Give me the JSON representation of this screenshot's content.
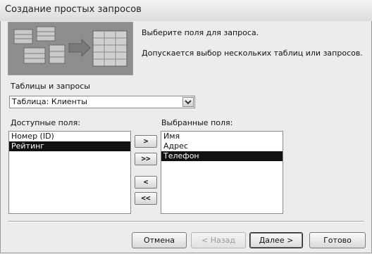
{
  "window": {
    "title": "Создание простых запросов"
  },
  "intro": {
    "line1": "Выберите поля для запроса.",
    "line2": "Допускается выбор нескольких таблиц или запросов."
  },
  "tables": {
    "label": "Таблицы и запросы",
    "selected": "Таблица: Клиенты"
  },
  "available": {
    "label": "Доступные поля:",
    "items": [
      "Номер (ID)",
      "Рейтинг"
    ],
    "selected_index": 1
  },
  "selected_fields": {
    "label": "Выбранные поля:",
    "items": [
      "Имя",
      "Адрес",
      "Телефон"
    ],
    "selected_index": 2
  },
  "move_buttons": {
    "add_one": ">",
    "add_all": ">>",
    "remove_one": "<",
    "remove_all": "<<"
  },
  "footer": {
    "cancel": "Отмена",
    "back": "< Назад",
    "next": "Далее >",
    "finish": "Готово"
  },
  "colors": {
    "selection": "#111111",
    "background": "#ececec"
  }
}
